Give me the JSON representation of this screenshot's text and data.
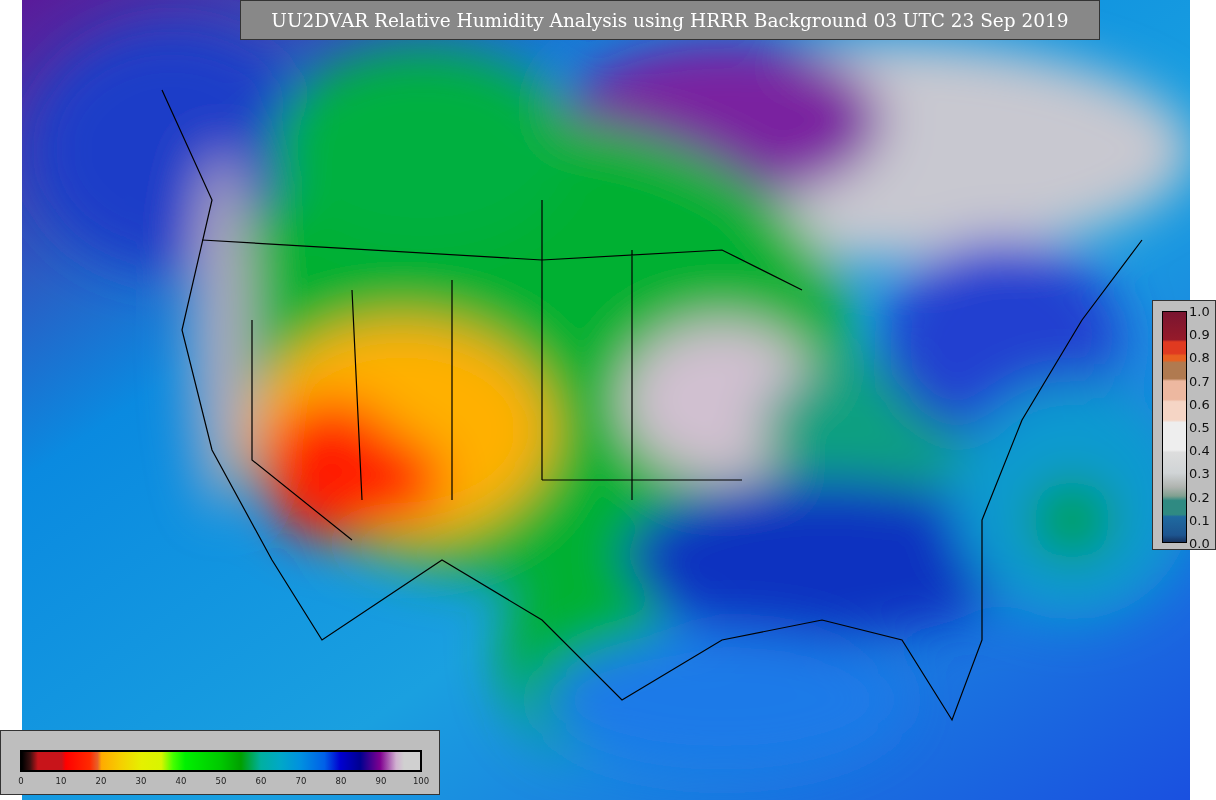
{
  "title": "UU2DVAR Relative Humidity Analysis using HRRR Background 03 UTC 23 Sep 2019",
  "humidity_colorbar": {
    "ticks": [
      "0",
      "10",
      "20",
      "30",
      "40",
      "50",
      "60",
      "70",
      "80",
      "90",
      "100"
    ]
  },
  "station_colorbar": {
    "ticks": [
      "1.0",
      "0.9",
      "0.8",
      "0.7",
      "0.6",
      "0.5",
      "0.4",
      "0.3",
      "0.2",
      "0.1",
      "0.0"
    ]
  }
}
